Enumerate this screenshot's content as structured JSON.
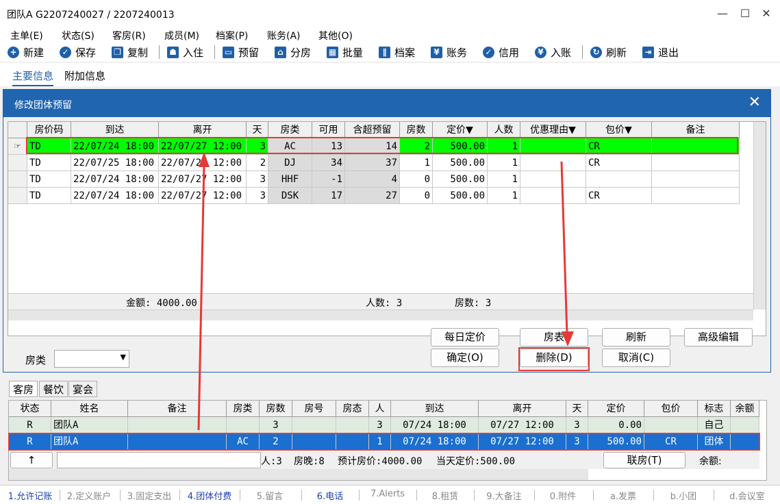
{
  "window": {
    "title": "团队A  G2207240027 / 2207240013",
    "min": "—",
    "max": "☐",
    "close": "✕"
  },
  "menu": [
    "主单(E)",
    "状态(S)",
    "客房(R)",
    "成员(M)",
    "档案(P)",
    "账务(A)",
    "其他(O)"
  ],
  "toolbar": [
    {
      "label": "新建",
      "icon": "plus-icon",
      "glyph": "+"
    },
    {
      "label": "保存",
      "icon": "check-icon",
      "glyph": "✓"
    },
    {
      "label": "复制",
      "icon": "copy-icon",
      "glyph": "❐"
    },
    {
      "label": "入住",
      "icon": "person-icon",
      "glyph": "☗"
    },
    {
      "label": "预留",
      "icon": "calendar-icon",
      "glyph": "▭"
    },
    {
      "label": "分房",
      "icon": "house-icon",
      "glyph": "⌂"
    },
    {
      "label": "批量",
      "icon": "grid-icon",
      "glyph": "▦"
    },
    {
      "label": "档案",
      "icon": "books-icon",
      "glyph": "∥"
    },
    {
      "label": "账务",
      "icon": "cash-icon",
      "glyph": "¥"
    },
    {
      "label": "信用",
      "icon": "shield-icon",
      "glyph": "✓"
    },
    {
      "label": "入账",
      "icon": "yen-icon",
      "glyph": "¥"
    },
    {
      "label": "刷新",
      "icon": "refresh-icon",
      "glyph": "↻"
    },
    {
      "label": "退出",
      "icon": "exit-icon",
      "glyph": "⇥"
    }
  ],
  "tabs": {
    "main": "主要信息",
    "extra": "附加信息"
  },
  "dialog": {
    "title": "修改团体预留",
    "close": "✕",
    "headers": [
      "房价码",
      "到达",
      "离开",
      "天",
      "房类",
      "可用",
      "含超预留",
      "房数",
      "定价▼",
      "人数",
      "优惠理由▼",
      "包价▼",
      "备注"
    ],
    "rows": [
      [
        "TD",
        "22/07/24 18:00",
        "22/07/27 12:00",
        "3",
        "AC",
        "13",
        "14",
        "2",
        "500.00",
        "1",
        "",
        "CR",
        ""
      ],
      [
        "TD",
        "22/07/25 18:00",
        "22/07/27 12:00",
        "2",
        "DJ",
        "34",
        "37",
        "1",
        "500.00",
        "1",
        "",
        "CR",
        ""
      ],
      [
        "TD",
        "22/07/24 18:00",
        "22/07/27 12:00",
        "3",
        "HHF",
        "-1",
        "4",
        "0",
        "500.00",
        "1",
        "",
        "",
        ""
      ],
      [
        "TD",
        "22/07/24 18:00",
        "22/07/27 12:00",
        "3",
        "DSK",
        "17",
        "27",
        "0",
        "500.00",
        "1",
        "",
        "CR",
        ""
      ]
    ],
    "summary": {
      "amount": "金额: 4000.00",
      "persons": "人数: 3",
      "rooms": "房数: 3"
    },
    "buttons": {
      "daily": "每日定价",
      "roomtable": "房表",
      "refresh": "刷新",
      "advanced": "高级编辑",
      "ok": "确定(O)",
      "delete": "删除(D)",
      "cancel": "取消(C)"
    },
    "roomtype_label": "房类",
    "roomtype_value": ""
  },
  "lower": {
    "tabs": [
      "客房",
      "餐饮",
      "宴会"
    ],
    "headers": [
      "状态",
      "姓名",
      "备注",
      "房类",
      "房数",
      "房号",
      "房态",
      "人",
      "到达",
      "离开",
      "天",
      "定价",
      "包价",
      "标志",
      "余额"
    ],
    "rows": [
      [
        "R",
        "团队A",
        "",
        "",
        "3",
        "",
        "",
        "3",
        "07/24 18:00",
        "07/27 12:00",
        "3",
        "0.00",
        "",
        "自己",
        ""
      ],
      [
        "R",
        "团队A",
        "",
        "AC",
        "2",
        "",
        "",
        "1",
        "07/24 18:00",
        "07/27 12:00",
        "3",
        "500.00",
        "CR",
        "团体",
        ""
      ]
    ],
    "footer": {
      "up": "↑",
      "persons": "人:3",
      "nights": "房晚:8",
      "total": "预计房价:4000.00",
      "today": "当天定价:500.00",
      "link": "联房(T)",
      "balance": "余额:"
    }
  },
  "statusbar": [
    {
      "label": "1.允许记账",
      "active": true
    },
    {
      "label": "2.定义账户",
      "active": false
    },
    {
      "label": "3.固定支出",
      "active": false
    },
    {
      "label": "4.团体付费",
      "active": true
    },
    {
      "label": "5.留言",
      "active": false
    },
    {
      "label": "6.电话",
      "active": true
    },
    {
      "label": "7.Alerts",
      "active": false
    },
    {
      "label": "8.租赁",
      "active": false
    },
    {
      "label": "9.大备注",
      "active": false
    },
    {
      "label": "0.附件",
      "active": false
    },
    {
      "label": "a.发票",
      "active": false
    },
    {
      "label": "b.小团",
      "active": false
    },
    {
      "label": "d.会议室",
      "active": false
    }
  ],
  "colors": {
    "accent": "#2065b0",
    "selected": "#1a6fd0",
    "highlight": "#00ff00",
    "annotation": "#e53935"
  }
}
